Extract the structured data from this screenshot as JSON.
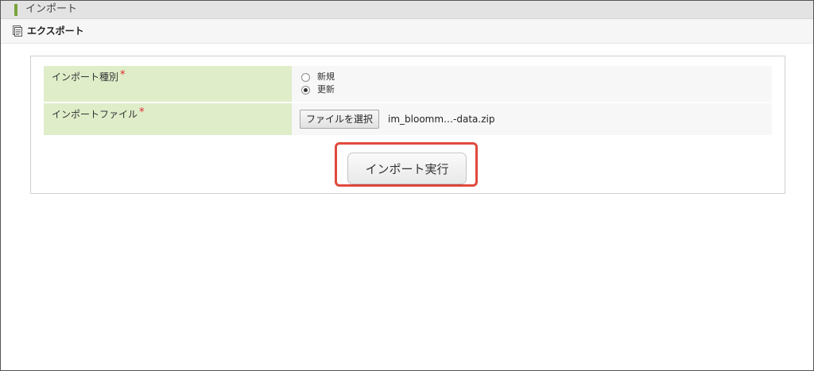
{
  "header": {
    "title": "インポート"
  },
  "subbar": {
    "export_label": "エクスポート"
  },
  "form": {
    "import_type": {
      "label": "インポート種別",
      "required_mark": "*",
      "options": [
        {
          "label": "新規",
          "checked": false
        },
        {
          "label": "更新",
          "checked": true
        }
      ]
    },
    "import_file": {
      "label": "インポートファイル",
      "required_mark": "*",
      "choose_button": "ファイルを選択",
      "file_name": "im_bloomm…-data.zip"
    },
    "submit_label": "インポート実行"
  },
  "colors": {
    "accent_green": "#78a33a",
    "label_bg": "#dfedc9",
    "required": "#e0242a",
    "highlight_border": "#e04a3e"
  },
  "icons": {
    "header": "green-bar-icon",
    "export": "document-stack-icon"
  }
}
